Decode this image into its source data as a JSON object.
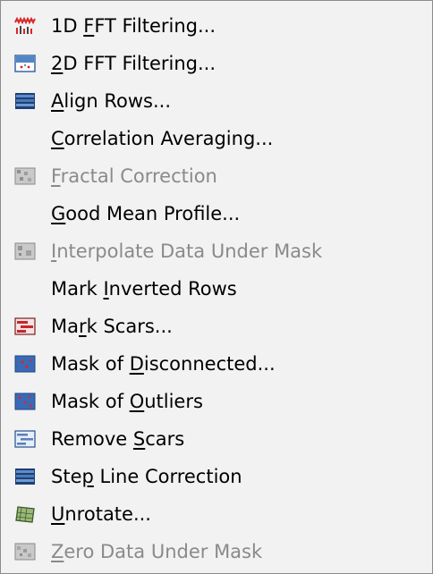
{
  "menu": {
    "items": [
      {
        "id": "1d-fft",
        "label": "1D FFT Filtering...",
        "mnemonic_index": 3,
        "enabled": true,
        "icon": "fft-1d-icon"
      },
      {
        "id": "2d-fft",
        "label": "2D FFT Filtering...",
        "mnemonic_index": 0,
        "enabled": true,
        "icon": "fft-2d-icon"
      },
      {
        "id": "align-rows",
        "label": "Align Rows...",
        "mnemonic_index": 0,
        "enabled": true,
        "icon": "align-rows-icon"
      },
      {
        "id": "correlation-averaging",
        "label": "Correlation Averaging...",
        "mnemonic_index": 0,
        "enabled": true,
        "icon": ""
      },
      {
        "id": "fractal-correction",
        "label": "Fractal Correction",
        "mnemonic_index": 0,
        "enabled": false,
        "icon": "fractal-correction-icon"
      },
      {
        "id": "good-mean-profile",
        "label": "Good Mean Profile...",
        "mnemonic_index": 0,
        "enabled": true,
        "icon": ""
      },
      {
        "id": "interpolate-data-under-mask",
        "label": "Interpolate Data Under Mask",
        "mnemonic_index": 0,
        "enabled": false,
        "icon": "interpolate-mask-icon"
      },
      {
        "id": "mark-inverted-rows",
        "label": "Mark Inverted Rows",
        "mnemonic_index": 5,
        "enabled": true,
        "icon": ""
      },
      {
        "id": "mark-scars",
        "label": "Mark Scars...",
        "mnemonic_index": 2,
        "enabled": true,
        "icon": "mark-scars-icon"
      },
      {
        "id": "mask-disconnected",
        "label": "Mask of Disconnected...",
        "mnemonic_index": 8,
        "enabled": true,
        "icon": "mask-disconnected-icon"
      },
      {
        "id": "mask-outliers",
        "label": "Mask of Outliers",
        "mnemonic_index": 8,
        "enabled": true,
        "icon": "mask-outliers-icon"
      },
      {
        "id": "remove-scars",
        "label": "Remove Scars",
        "mnemonic_index": 7,
        "enabled": true,
        "icon": "remove-scars-icon"
      },
      {
        "id": "step-line-correction",
        "label": "Step Line Correction",
        "mnemonic_index": 3,
        "enabled": true,
        "icon": "step-line-correction-icon"
      },
      {
        "id": "unrotate",
        "label": "Unrotate...",
        "mnemonic_index": 0,
        "enabled": true,
        "icon": "unrotate-icon"
      },
      {
        "id": "zero-data-under-mask",
        "label": "Zero Data Under Mask",
        "mnemonic_index": 0,
        "enabled": false,
        "icon": "zero-data-mask-icon"
      }
    ]
  }
}
